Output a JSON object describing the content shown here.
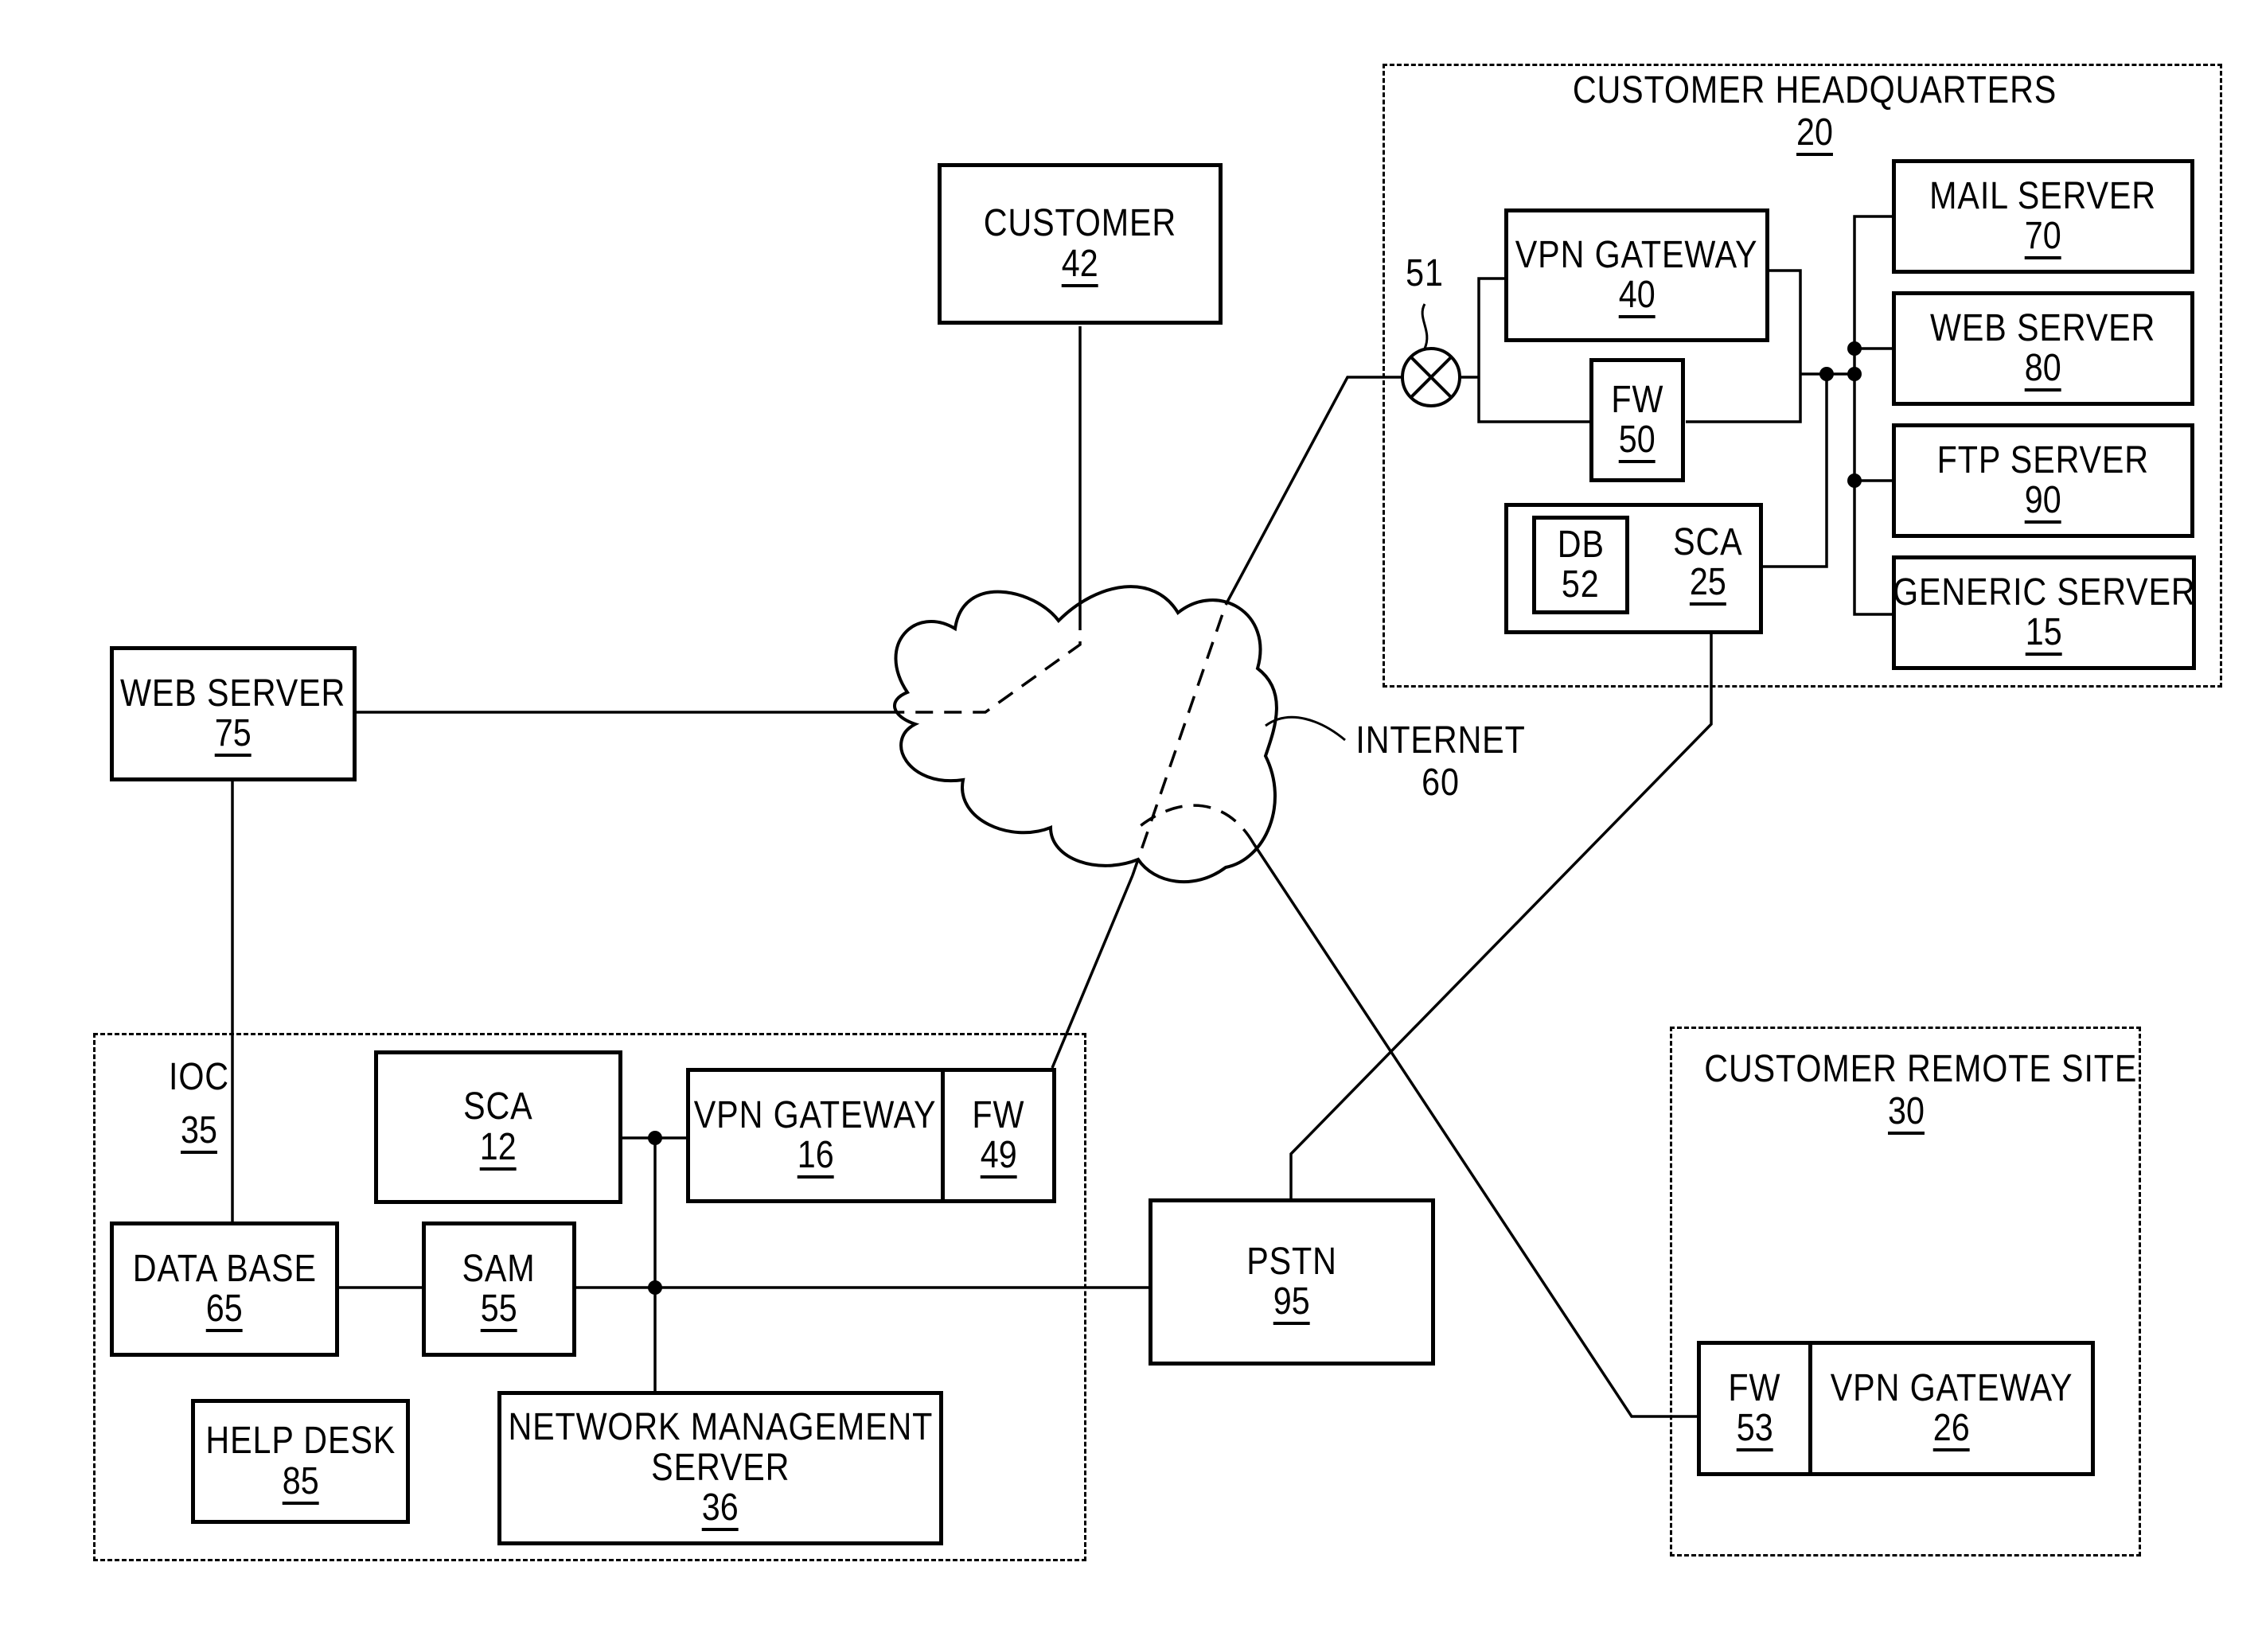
{
  "diagram": {
    "groups": {
      "hq": {
        "title": "CUSTOMER HEADQUARTERS",
        "ref": "20"
      },
      "remote": {
        "title": "CUSTOMER REMOTE SITE",
        "ref": "30"
      },
      "ioc": {
        "title": "IOC",
        "ref": "35"
      }
    },
    "nodes": {
      "customer": {
        "label": "CUSTOMER",
        "ref": "42"
      },
      "web_server_75": {
        "label": "WEB SERVER",
        "ref": "75"
      },
      "vpn_gateway_40": {
        "label": "VPN GATEWAY",
        "ref": "40"
      },
      "fw_50": {
        "label": "FW",
        "ref": "50"
      },
      "db_52": {
        "label": "DB",
        "ref": "52"
      },
      "sca_25": {
        "label": "SCA",
        "ref": "25"
      },
      "mail_server": {
        "label": "MAIL SERVER",
        "ref": "70"
      },
      "web_server_80": {
        "label": "WEB SERVER",
        "ref": "80"
      },
      "ftp_server": {
        "label": "FTP SERVER",
        "ref": "90"
      },
      "generic_server": {
        "label": "GENERIC SERVER",
        "ref": "15"
      },
      "switch_51": {
        "ref": "51"
      },
      "internet": {
        "label": "INTERNET",
        "ref": "60"
      },
      "sca_12": {
        "label": "SCA",
        "ref": "12"
      },
      "vpn_gateway_16": {
        "label": "VPN GATEWAY",
        "ref": "16"
      },
      "fw_49": {
        "label": "FW",
        "ref": "49"
      },
      "data_base": {
        "label": "DATA BASE",
        "ref": "65"
      },
      "sam": {
        "label": "SAM",
        "ref": "55"
      },
      "help_desk": {
        "label": "HELP DESK",
        "ref": "85"
      },
      "nms": {
        "label_line1": "NETWORK MANAGEMENT",
        "label_line2": "SERVER",
        "ref": "36"
      },
      "pstn": {
        "label": "PSTN",
        "ref": "95"
      },
      "fw_53": {
        "label": "FW",
        "ref": "53"
      },
      "vpn_gateway_26": {
        "label": "VPN GATEWAY",
        "ref": "26"
      }
    }
  }
}
